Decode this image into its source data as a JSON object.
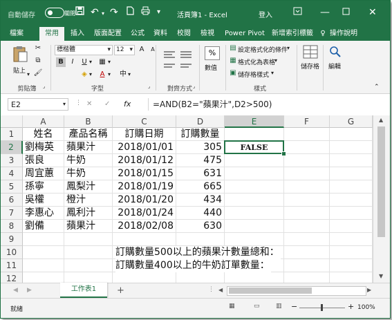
{
  "titlebar": {
    "autosave_label": "自動儲存",
    "autosave_state": "關閉",
    "title": "活頁簿1 - Excel",
    "signin": "登入",
    "icons": [
      "save-icon",
      "undo-icon",
      "redo-icon",
      "document-icon",
      "print-icon",
      "qat-dropdown-icon"
    ],
    "accent": "#217346"
  },
  "tabs": [
    "檔案",
    "常用",
    "插入",
    "版面配置",
    "公式",
    "資料",
    "校閱",
    "檢視",
    "Power Pivot",
    "新增索引標籤",
    "操作說明"
  ],
  "active_tab": "常用",
  "ribbon": {
    "clipboard": {
      "paste": "貼上",
      "label": "剪貼簿"
    },
    "font": {
      "name": "標楷體",
      "size": "12",
      "label": "字型",
      "bold": "B",
      "italic": "I",
      "underline": "U",
      "font_color_letter": "A",
      "phonetic": "中"
    },
    "alignment": {
      "label": "對齊方式"
    },
    "number": {
      "percent": "%",
      "label": "數值"
    },
    "styles": {
      "conditional": "設定格式化的條件",
      "format_table": "格式化為表格",
      "cell_styles": "儲存格樣式",
      "label": "樣式"
    },
    "cells": {
      "label": "儲存格"
    },
    "editing": {
      "label": "編輯"
    }
  },
  "formula_bar": {
    "name_box": "E2",
    "fx": "fx",
    "formula": "=AND(B2=\"蘋果汁\",D2>500)",
    "cancel": "✕",
    "enter": "✓"
  },
  "sheet": {
    "columns": [
      "A",
      "B",
      "C",
      "D",
      "E",
      "F",
      "G"
    ],
    "selected_column": "E",
    "selected_row": "2",
    "rows": [
      {
        "n": "1",
        "A": "姓名",
        "B": "產品名稱",
        "C": "訂購日期",
        "D": "訂購數量",
        "E": ""
      },
      {
        "n": "2",
        "A": "劉梅英",
        "B": "蘋果汁",
        "C": "2018/01/01",
        "D": "305",
        "E": "FALSE"
      },
      {
        "n": "3",
        "A": "張良",
        "B": "牛奶",
        "C": "2018/01/12",
        "D": "475",
        "E": ""
      },
      {
        "n": "4",
        "A": "周宜蕙",
        "B": "牛奶",
        "C": "2018/01/15",
        "D": "631",
        "E": ""
      },
      {
        "n": "5",
        "A": "孫寧",
        "B": "鳳梨汁",
        "C": "2018/01/19",
        "D": "665",
        "E": ""
      },
      {
        "n": "6",
        "A": "吳權",
        "B": "橙汁",
        "C": "2018/01/20",
        "D": "434",
        "E": ""
      },
      {
        "n": "7",
        "A": "李惠心",
        "B": "鳳利汁",
        "C": "2018/01/24",
        "D": "440",
        "E": ""
      },
      {
        "n": "8",
        "A": "劉備",
        "B": "蘋果汁",
        "C": "2018/02/08",
        "D": "630",
        "E": ""
      },
      {
        "n": "9",
        "A": "",
        "B": "",
        "C": "",
        "D": "",
        "E": ""
      },
      {
        "n": "10",
        "A": "",
        "B": "",
        "C": "",
        "D": "",
        "E": ""
      },
      {
        "n": "11",
        "A": "",
        "B": "",
        "C": "",
        "D": "",
        "E": ""
      },
      {
        "n": "12",
        "A": "",
        "B": "",
        "C": "",
        "D": "",
        "E": ""
      }
    ],
    "notes": {
      "row10": "訂購數量500以上的蘋果汁數量總和：",
      "row11": "訂購數量400以上的牛奶訂單數量："
    }
  },
  "sheet_tabs": {
    "active": "工作表1",
    "add": "+"
  },
  "statusbar": {
    "ready": "就緒",
    "zoom": "100%",
    "minus": "−",
    "plus": "+"
  }
}
